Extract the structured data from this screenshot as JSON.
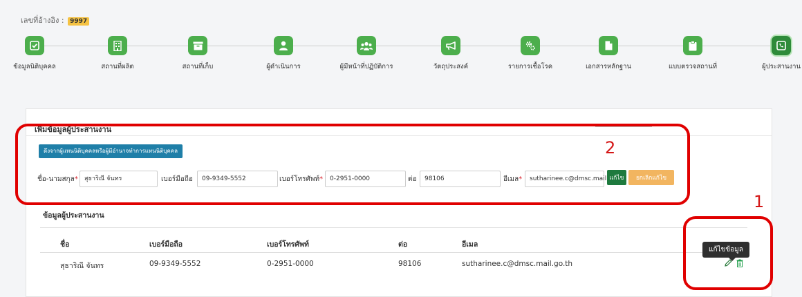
{
  "reference": {
    "label": "เลขที่อ้างอิง :",
    "number": "9997"
  },
  "steps": [
    {
      "label": "ข้อมูลนิติบุคคล",
      "icon": "check-icon"
    },
    {
      "label": "สถานที่ผลิต",
      "icon": "building-icon"
    },
    {
      "label": "สถานที่เก็บ",
      "icon": "archive-box-icon"
    },
    {
      "label": "ผู้ดำเนินการ",
      "icon": "user-icon"
    },
    {
      "label": "ผู้มีหน้าที่ปฏิบัติการ",
      "icon": "users-icon"
    },
    {
      "label": "วัตถุประสงค์",
      "icon": "megaphone-icon"
    },
    {
      "label": "รายการเชื้อโรค",
      "icon": "gears-icon"
    },
    {
      "label": "เอกสารหลักฐาน",
      "icon": "file-icon"
    },
    {
      "label": "แบบตรวจสถานที่",
      "icon": "clipboard-icon"
    },
    {
      "label": "ผู้ประสานงาน",
      "icon": "phone-icon"
    }
  ],
  "panel": {
    "title": "เพิ่มข้อมูลผู้ประสานงาน",
    "pull_button": "ดึงจากผู้แทนนิติบุคคลหรือผู้มีอำนาจทำการแทนนิติบุคคล",
    "form": {
      "name_label": "ชื่อ-นามสกุล",
      "name_value": "สุธาริณี จันทร",
      "mobile_label": "เบอร์มือถือ",
      "mobile_value": "09-9349-5552",
      "phone_label": "เบอร์โทรศัพท์",
      "phone_value": "0-2951-0000",
      "ext_label": "ต่อ",
      "ext_value": "98106",
      "email_label": "อีเมล",
      "email_value": "sutharinee.c@dmsc.mail.",
      "required_mark": "*",
      "save_button": "แก้ไข",
      "cancel_button": "ยกเลิกแก้ไข"
    },
    "section_title": "ข้อมูลผู้ประสานงาน",
    "table": {
      "headers": [
        "ชื่อ",
        "เบอร์มือถือ",
        "เบอร์โทรศัพท์",
        "ต่อ",
        "อีเมล"
      ],
      "rows": [
        [
          "สุธาริณี จันทร",
          "09-9349-5552",
          "0-2951-0000",
          "98106",
          "sutharinee.c@dmsc.mail.go.th"
        ]
      ]
    },
    "tooltip": "แก้ไขข้อมูล"
  },
  "annotations": {
    "one": "1",
    "two": "2"
  },
  "colors": {
    "step_green": "#4cae4c",
    "primary_blue": "#1f7fa8",
    "save_green": "#1e7a3e",
    "cancel_orange": "#f2b560",
    "annotation_red": "#e00000"
  }
}
